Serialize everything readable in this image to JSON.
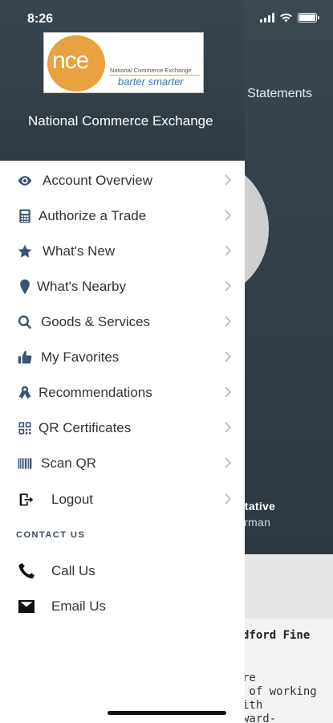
{
  "status_bar": {
    "time": "8:26"
  },
  "drawer": {
    "logo": {
      "mark": "nce",
      "name": "National Commerce Exchange",
      "tagline": "barter smarter"
    },
    "title": "National Commerce Exchange",
    "menu": [
      {
        "label": "Account Overview",
        "icon": "eye-icon"
      },
      {
        "label": "Authorize a Trade",
        "icon": "calculator-icon"
      },
      {
        "label": "What's New",
        "icon": "star-icon"
      },
      {
        "label": "What's Nearby",
        "icon": "map-pin-icon"
      },
      {
        "label": "Goods & Services",
        "icon": "search-icon"
      },
      {
        "label": "My Favorites",
        "icon": "thumbs-up-icon"
      },
      {
        "label": "Recommendations",
        "icon": "ribbon-icon"
      },
      {
        "label": "QR Certificates",
        "icon": "qr-code-icon"
      },
      {
        "label": "Scan QR",
        "icon": "barcode-icon"
      },
      {
        "label": "Logout",
        "icon": "logout-icon"
      }
    ],
    "contact_section": {
      "label": "CONTACT US",
      "items": [
        {
          "label": "Call Us",
          "icon": "phone-icon"
        },
        {
          "label": "Email Us",
          "icon": "envelope-icon"
        }
      ]
    }
  },
  "background": {
    "statements_tab": "Statements",
    "rep_title": "ntative",
    "rep_name": "urman",
    "card_title": "dford Fine",
    "card_text": "re\n of working\nith\nward-"
  },
  "colors": {
    "accent": "#3b5371",
    "header": "#33404a",
    "logo_orange": "#e8a23f"
  }
}
